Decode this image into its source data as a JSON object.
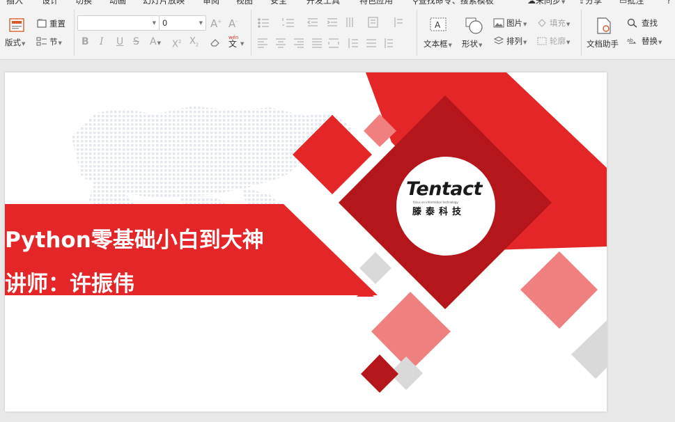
{
  "menubar": {
    "items": [
      "插入",
      "设计",
      "切换",
      "动画",
      "幻灯片放映",
      "审阅",
      "视图",
      "安全",
      "开发工具",
      "特色应用"
    ],
    "search": "查找命令、搜索模板",
    "sync": "未同步",
    "share": "分享",
    "comment": "批注",
    "help": "?"
  },
  "ribbon": {
    "layout_label": "版式",
    "reset_label": "重置",
    "section_label": "节",
    "font_name": "",
    "font_size": "0",
    "textbox_label": "文本框",
    "shape_label": "形状",
    "picture_label": "图片",
    "arrange_label": "排列",
    "fill_label": "填充",
    "outline_label": "轮廓",
    "doc_helper_label": "文档助手",
    "find_label": "查找",
    "replace_label": "替换",
    "pinyin_label": "wén",
    "pinyin_char": "文"
  },
  "slide": {
    "title_line1": "Python零基础小白到大神",
    "title_line2": "讲师：许振伟",
    "logo_word": "Tentact",
    "logo_tagline": "focus on information technology",
    "logo_chinese": "滕泰科技"
  },
  "colors": {
    "brand_red": "#e52628",
    "dark_red": "#b4161c",
    "light_red": "#f08080",
    "grey_diamond": "#d9d9d9",
    "ribbon_bg": "#f3f3f3"
  }
}
